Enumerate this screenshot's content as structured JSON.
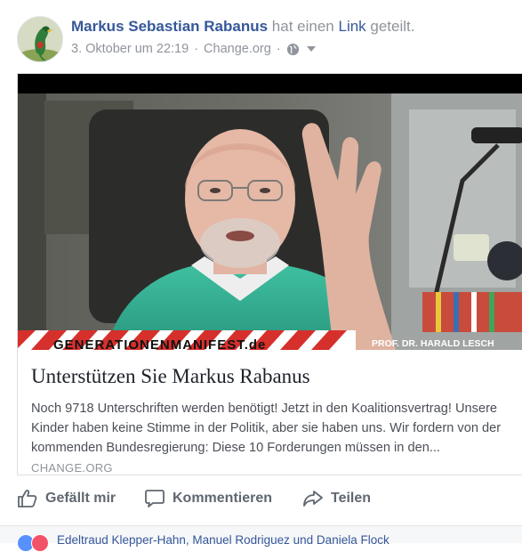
{
  "post": {
    "author": "Markus Sebastian Rabanus",
    "action_prefix": " hat einen ",
    "action_link": "Link",
    "action_suffix": " geteilt.",
    "timestamp": "3. Oktober um 22:19",
    "separator": "·",
    "via": "Change.org",
    "audience_icon": "globe-icon"
  },
  "video": {
    "banner_text": "GENERATIONENMANIFEST.de",
    "caption": "PROF. DR. HARALD LESCH"
  },
  "link_card": {
    "title": "Unterstützen Sie Markus Rabanus",
    "description": "Noch 9718 Unterschriften werden benötigt! Jetzt in den Koalitionsvertrag! Unsere Kinder haben keine Stimme in der Politik, aber sie haben uns. Wir fordern von der kommenden Bundesregierung: Diese 10 Forderungen müssen in den...",
    "source": "CHANGE.ORG"
  },
  "actions": {
    "like": "Gefällt mir",
    "comment": "Kommentieren",
    "share": "Teilen"
  },
  "reactions": {
    "names": "Edeltraud Klepper-Hahn, Manuel Rodriguez und Daniela Flock"
  },
  "colors": {
    "link_blue": "#365899",
    "meta_gray": "#90949c",
    "action_gray": "#606770"
  }
}
